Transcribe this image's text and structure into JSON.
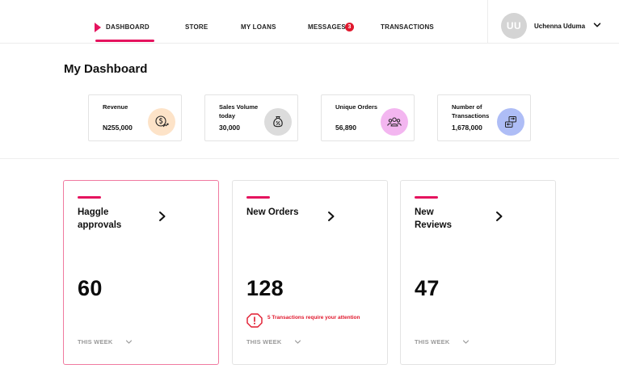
{
  "nav": {
    "items": [
      {
        "label": "DASHBOARD",
        "active": true
      },
      {
        "label": "STORE"
      },
      {
        "label": "MY LOANS"
      },
      {
        "label": "MESSAGES",
        "badge": "3"
      },
      {
        "label": "TRANSACTIONS"
      }
    ],
    "accent_color": "#e5135e"
  },
  "user": {
    "initials": "UU",
    "name": "Uchenna Uduma"
  },
  "page": {
    "title": "My Dashboard"
  },
  "stats": [
    {
      "label": "Revenue",
      "value": "N255,000",
      "icon": "dollar-growth-icon",
      "icon_bg": "#fde3c8"
    },
    {
      "label": "Sales Volume today",
      "value": "30,000",
      "icon": "sales-bag-icon",
      "icon_bg": "#dcdcdc"
    },
    {
      "label": "Unique Orders",
      "value": "56,890",
      "icon": "users-group-icon",
      "icon_bg": "#f3b6f0"
    },
    {
      "label": "Number of Transactions",
      "value": "1,678,000",
      "icon": "transfer-icon",
      "icon_bg": "#aebdf6"
    }
  ],
  "cards": [
    {
      "title": "Haggle approvals",
      "count": "60",
      "period": "THIS WEEK",
      "selected": true
    },
    {
      "title": "New Orders",
      "count": "128",
      "period": "THIS WEEK",
      "alert": "5 Transactions require your attention"
    },
    {
      "title": "New Reviews",
      "count": "47",
      "period": "THIS WEEK"
    }
  ]
}
